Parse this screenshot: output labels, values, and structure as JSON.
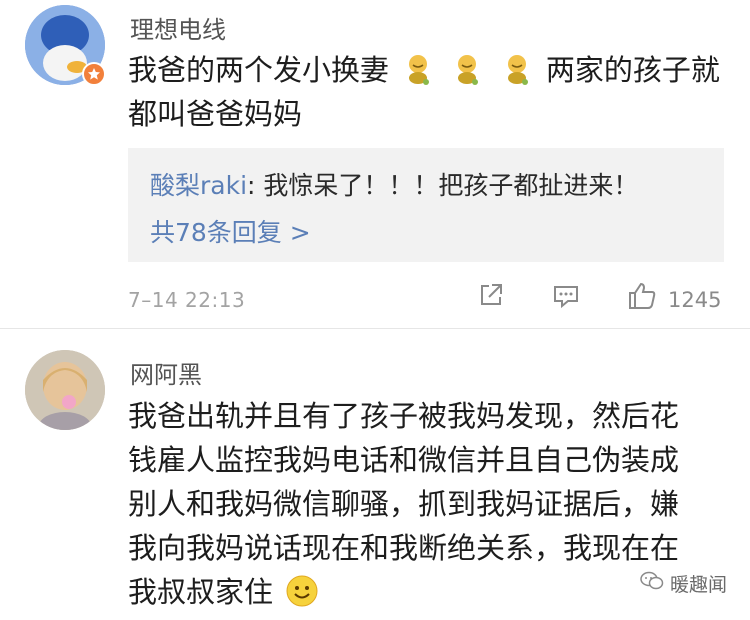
{
  "comments": [
    {
      "username": "理想电线",
      "text_line1": "我爸的两个发小换妻",
      "text_line1_end": "两家的孩子就",
      "text_line2": "都叫爸爸妈妈",
      "reply_preview": {
        "user": "酸梨raki",
        "separator": ": ",
        "text": "我惊呆了！！！把孩子都扯进来！"
      },
      "more_replies": "共78条回复 >",
      "time": "7–14 22:13",
      "like_count": "1245"
    },
    {
      "username": "网阿黑",
      "lines": [
        "我爸出轨并且有了孩子被我妈发现，然后花",
        "钱雇人监控我妈电话和微信并且自己伪装成",
        "别人和我妈微信聊骚，抓到我妈证据后，嫌",
        "我向我妈说话现在和我断绝关系，我现在在",
        "我叔叔家住"
      ]
    }
  ],
  "watermark": "暖趣闻",
  "icons": [
    "share-icon",
    "comment-icon",
    "thumbs-up-icon",
    "emoji-icon",
    "wechat-icon"
  ],
  "colors": {
    "link": "#5b7fb7",
    "badge": "#f2803b",
    "reply_bg": "#f2f2f2"
  }
}
